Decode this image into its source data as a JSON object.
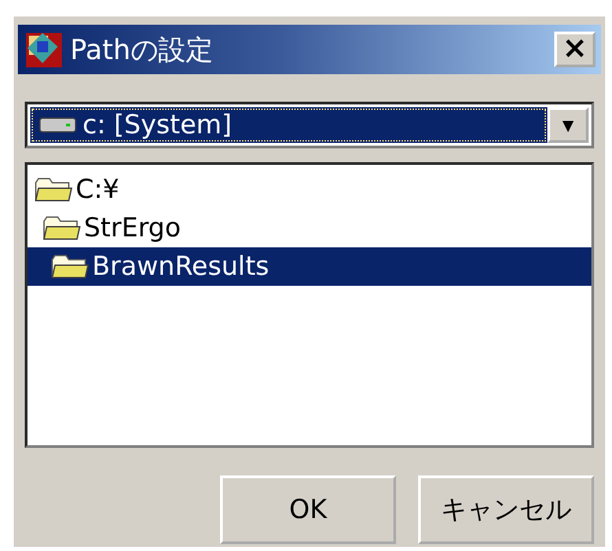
{
  "window": {
    "title": "Pathの設定",
    "close": "×"
  },
  "drive": {
    "value": "c: [System]",
    "arrow": "▼"
  },
  "tree": [
    {
      "label": "C:¥",
      "selected": false,
      "children": [
        {
          "label": "StrErgo",
          "selected": false,
          "children": [
            {
              "label": "BrawnResults",
              "selected": true
            }
          ]
        }
      ]
    }
  ],
  "buttons": [
    "OK",
    "キャンセル"
  ]
}
